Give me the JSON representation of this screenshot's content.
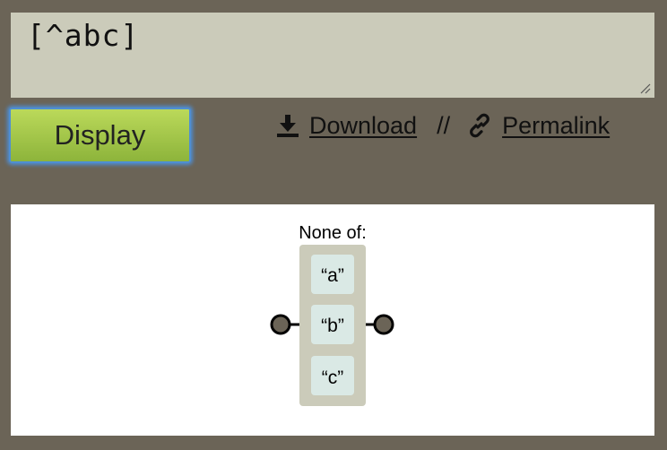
{
  "input": {
    "value": "[^abc]"
  },
  "toolbar": {
    "display_label": "Display",
    "download_label": "Download",
    "separator": "//",
    "permalink_label": "Permalink"
  },
  "diagram": {
    "set_label": "None of:",
    "items": [
      "“a”",
      "“b”",
      "“c”"
    ]
  },
  "colors": {
    "background": "#6b6457",
    "input_bg": "#cbcbba",
    "button_top": "#bbd95a",
    "button_bottom": "#8db43b",
    "focus_ring": "#4f8ed2",
    "set_box": "#cbcbba",
    "literal_box": "#dae9e5",
    "node": "#6b6457"
  },
  "icons": [
    "resize-grip-icon",
    "download-icon",
    "link-icon",
    "start-node-icon",
    "end-node-icon"
  ]
}
